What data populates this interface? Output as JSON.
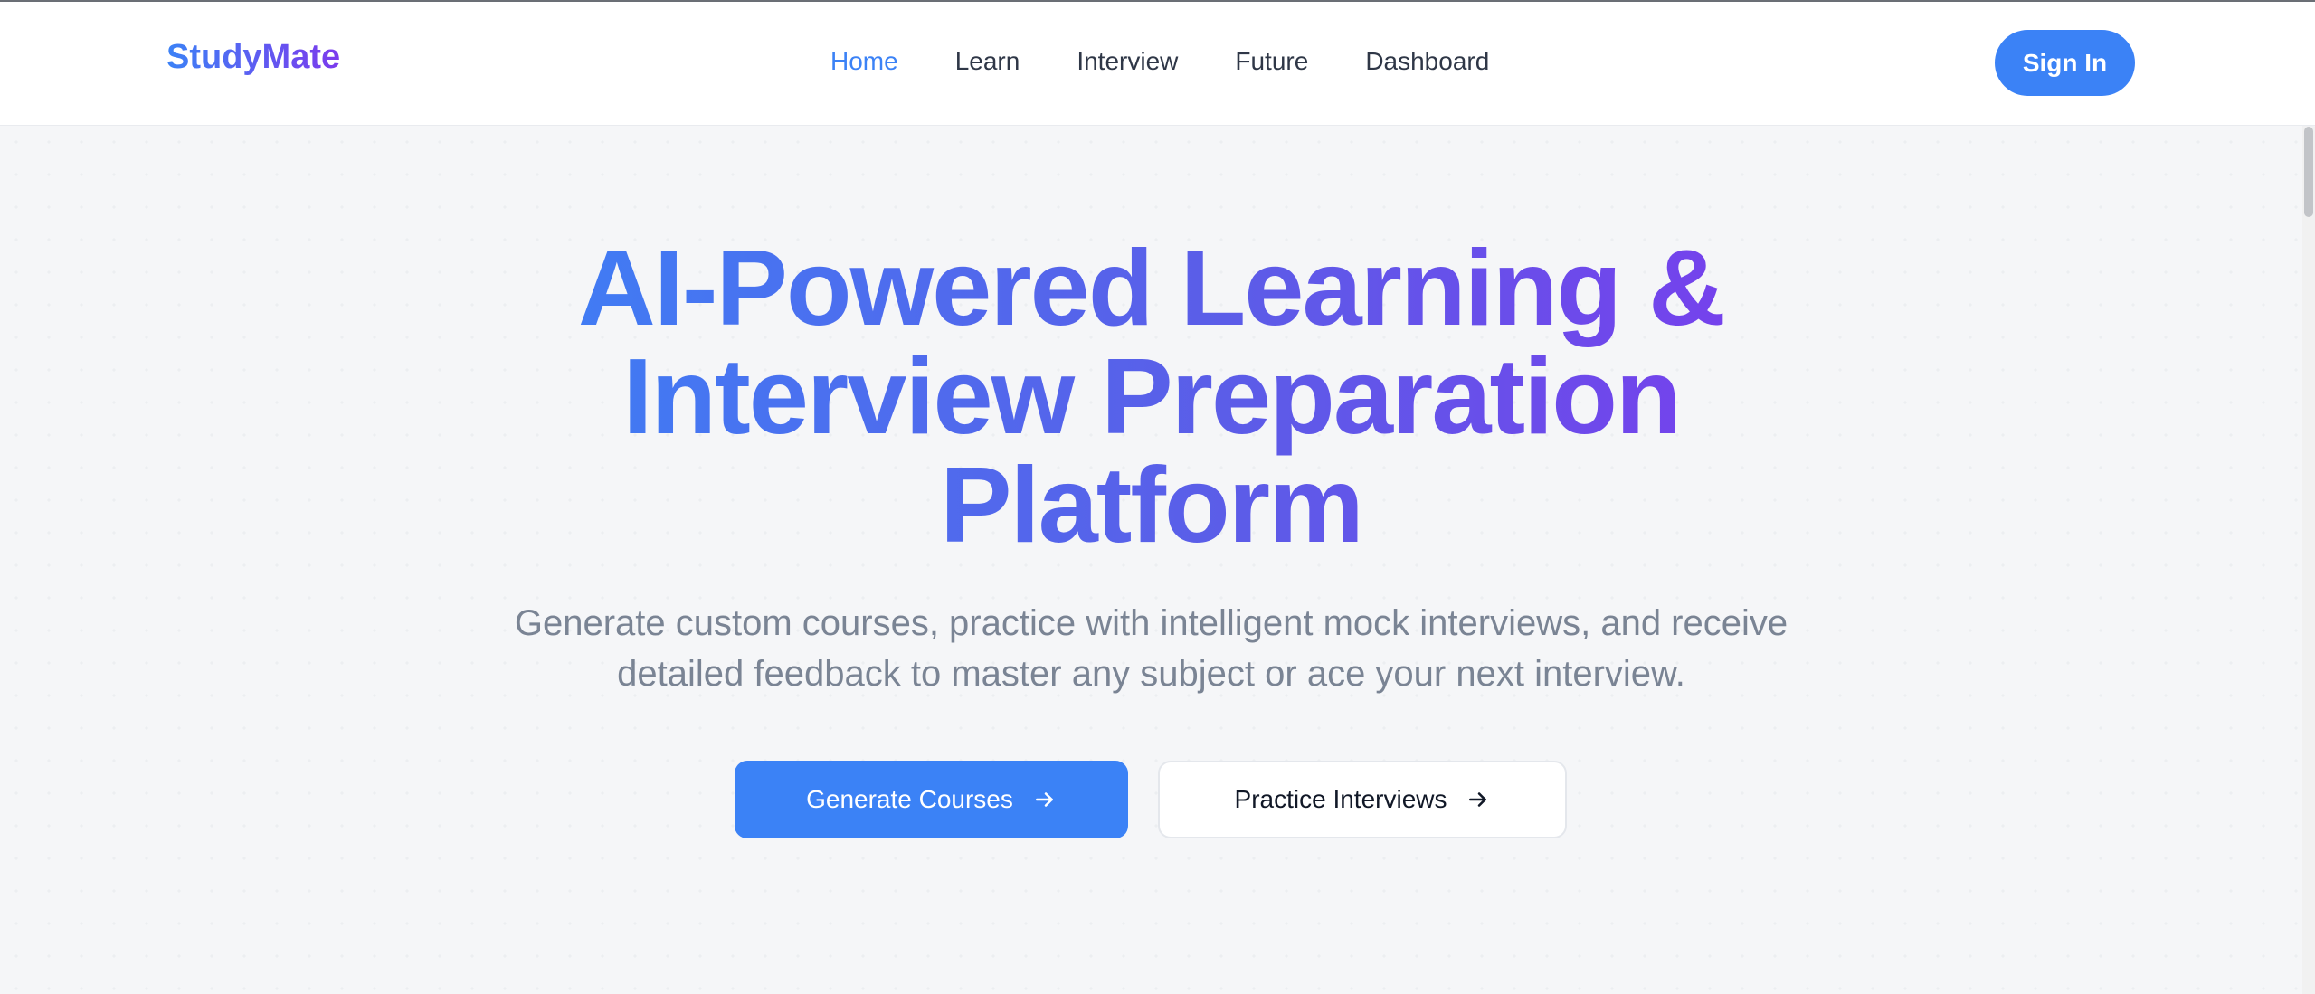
{
  "nav": {
    "logo": "StudyMate",
    "links": [
      {
        "label": "Home",
        "active": true
      },
      {
        "label": "Learn",
        "active": false
      },
      {
        "label": "Interview",
        "active": false
      },
      {
        "label": "Future",
        "active": false
      },
      {
        "label": "Dashboard",
        "active": false
      }
    ],
    "sign_in_label": "Sign In"
  },
  "hero": {
    "title_lines": [
      "AI-Powered Learning &",
      "Interview Preparation",
      "Platform"
    ],
    "subtitle_lines": [
      "Generate custom courses, practice with intelligent mock interviews, and receive",
      "detailed feedback to master any subject or ace your next interview."
    ],
    "primary_button": {
      "label": "Generate Courses",
      "icon": "arrow-right-icon"
    },
    "secondary_button": {
      "label": "Practice Interviews",
      "icon": "arrow-right-icon"
    }
  },
  "colors": {
    "accent": "#3b82f6",
    "gradient_start": "#3b82f6",
    "gradient_end": "#7c3aed",
    "nav_text": "#2f3747",
    "subtitle_text": "#7a8494",
    "page_background": "#f5f6f8"
  }
}
